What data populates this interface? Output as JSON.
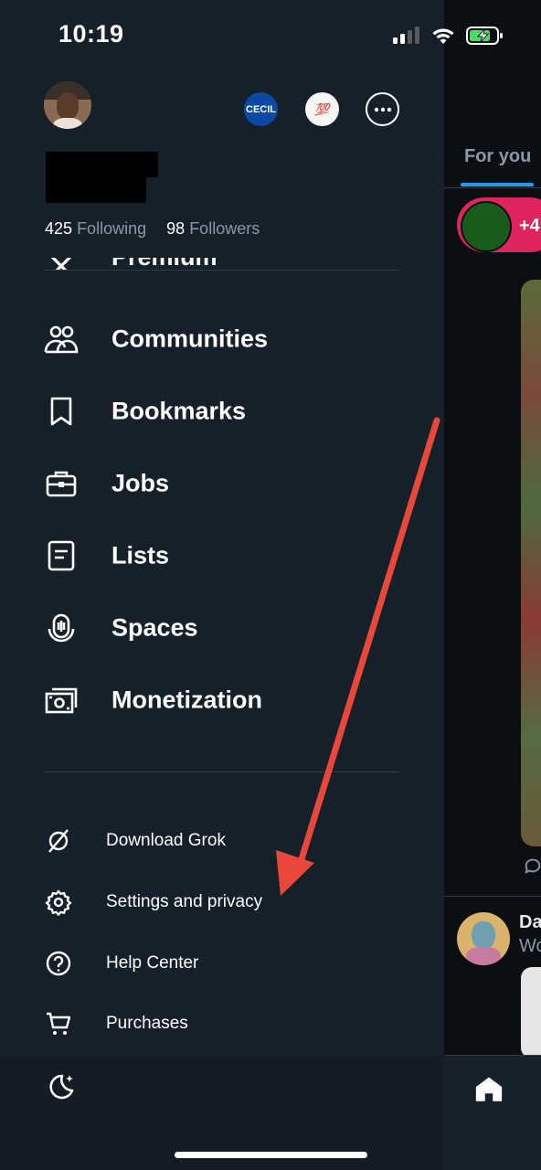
{
  "status_bar": {
    "time": "10:19"
  },
  "profile": {
    "following_count": "425",
    "following_label": "Following",
    "followers_count": "98",
    "followers_label": "Followers",
    "accounts": [
      {
        "badge_text": "CECIL"
      },
      {
        "badge_text": "💯"
      }
    ]
  },
  "menu": {
    "partial_item": "Premium",
    "items": [
      {
        "label": "Communities",
        "icon": "communities-icon"
      },
      {
        "label": "Bookmarks",
        "icon": "bookmark-icon"
      },
      {
        "label": "Jobs",
        "icon": "briefcase-icon"
      },
      {
        "label": "Lists",
        "icon": "list-icon"
      },
      {
        "label": "Spaces",
        "icon": "spaces-icon"
      },
      {
        "label": "Monetization",
        "icon": "money-icon"
      }
    ],
    "secondary": [
      {
        "label": "Download Grok",
        "icon": "grok-icon"
      },
      {
        "label": "Settings and privacy",
        "icon": "gear-icon"
      },
      {
        "label": "Help Center",
        "icon": "help-icon"
      },
      {
        "label": "Purchases",
        "icon": "cart-icon"
      }
    ]
  },
  "background_feed": {
    "tab_label": "For you",
    "badge_text": "+4",
    "post_author": "Da",
    "post_text": "Wo"
  },
  "colors": {
    "drawer_bg": "#15202b",
    "accent": "#1d9bf0",
    "annotation_arrow": "#e8473a"
  }
}
